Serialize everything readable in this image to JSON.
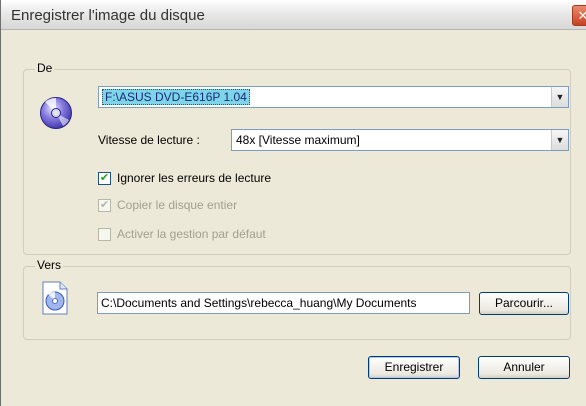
{
  "window": {
    "title": "Enregistrer l'image du disque",
    "close_symbol": "✕"
  },
  "source": {
    "group_label": "De",
    "drive_value": "F:\\ASUS DVD-E616P 1.04",
    "speed_label": "Vitesse de lecture :",
    "speed_value": "48x [Vitesse maximum]",
    "ignore_errors_label": "Ignorer les erreurs de lecture",
    "ignore_errors_checked": true,
    "copy_entire_label": "Copier le disque entier",
    "copy_entire_checked": true,
    "default_mgmt_label": "Activer la gestion par défaut",
    "default_mgmt_checked": false,
    "icon": "disc-icon"
  },
  "destination": {
    "group_label": "Vers",
    "path_value": "C:\\Documents and Settings\\rebecca_huang\\My Documents",
    "browse_label": "Parcourir...",
    "icon": "image-file-icon"
  },
  "actions": {
    "save_label": "Enregistrer",
    "cancel_label": "Annuler"
  },
  "check_symbol": "✔"
}
